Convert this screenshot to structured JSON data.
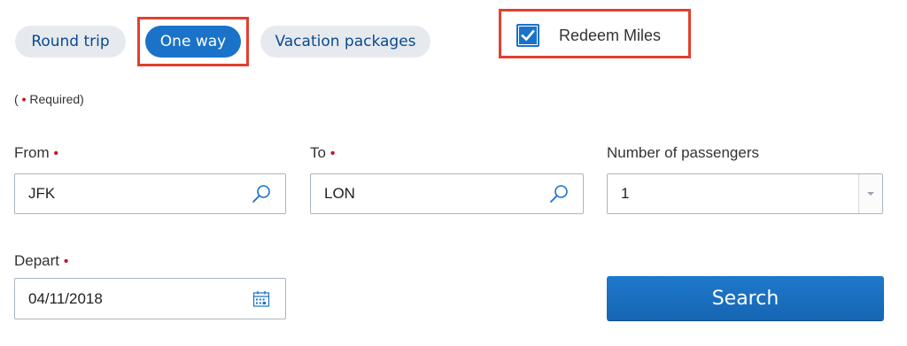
{
  "trip_types": {
    "round_trip": "Round trip",
    "one_way": "One way",
    "vacation_packages": "Vacation packages"
  },
  "redeem": {
    "label": "Redeem Miles",
    "checked": true
  },
  "required_note": {
    "open": "(",
    "text": "Required)"
  },
  "required_marker": "•",
  "from": {
    "label": "From",
    "value": "JFK",
    "icon": "search-icon"
  },
  "to": {
    "label": "To",
    "value": "LON",
    "icon": "search-icon"
  },
  "passengers": {
    "label": "Number of passengers",
    "value": "1",
    "icon": "chevron-down-icon"
  },
  "depart": {
    "label": "Depart",
    "value": "04/11/2018",
    "icon": "calendar-icon"
  },
  "search_button": "Search",
  "colors": {
    "accent": "#1a73c8",
    "highlight": "#e33f2f",
    "required": "#c8102e",
    "tab_bg": "#e6eaee"
  }
}
